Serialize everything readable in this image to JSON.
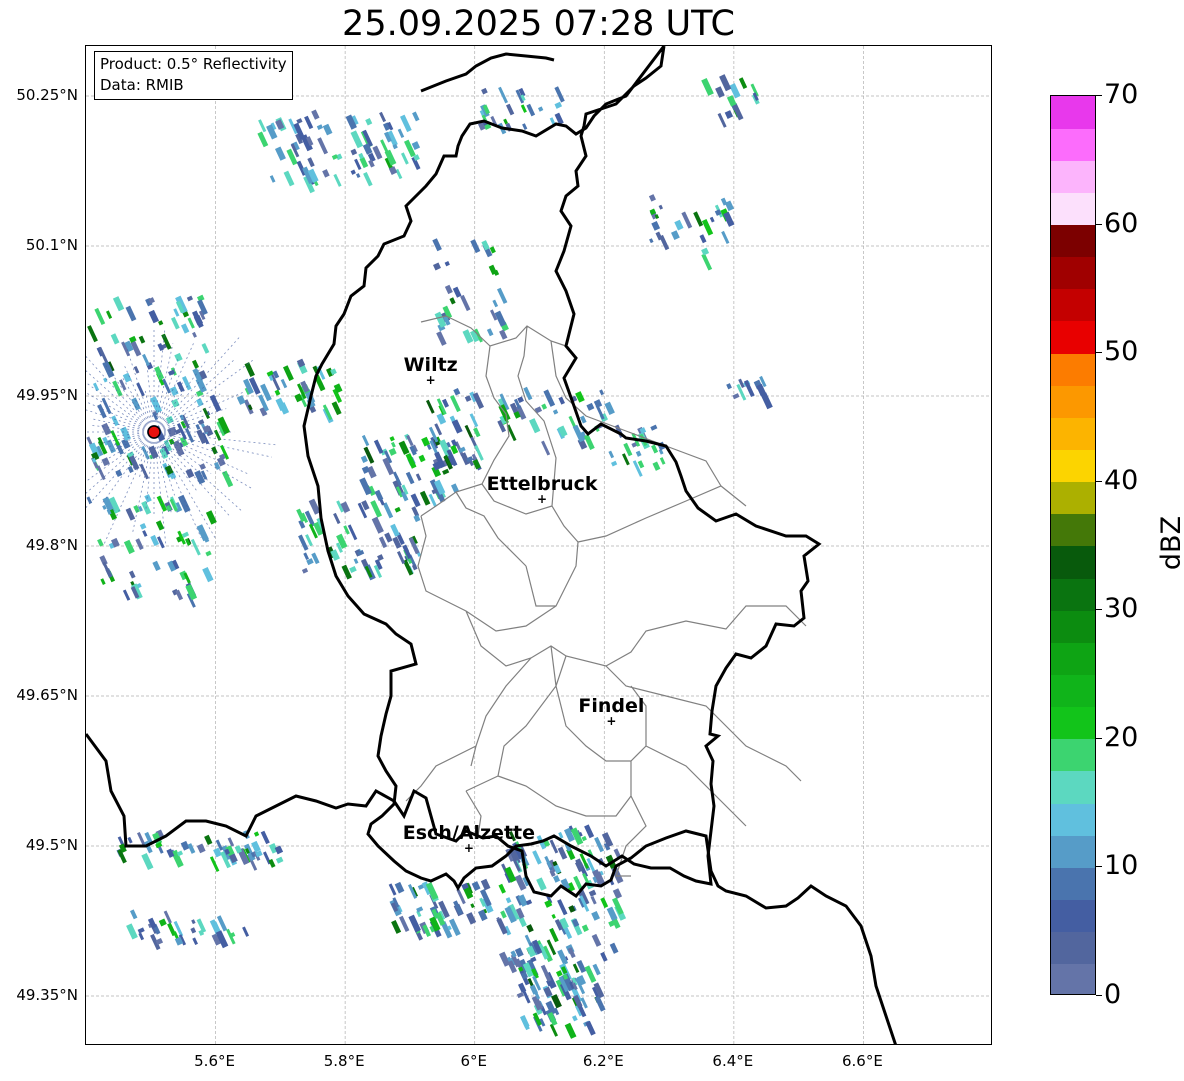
{
  "title": "25.09.2025 07:28 UTC",
  "info": {
    "product": "Product: 0.5° Reflectivity",
    "data": "Data: RMIB"
  },
  "map": {
    "lon_range": [
      5.4,
      6.8
    ],
    "lat_range": [
      49.3,
      50.3
    ],
    "lat_ticks": [
      {
        "value": 50.25,
        "label": "50.25°N"
      },
      {
        "value": 50.1,
        "label": "50.1°N"
      },
      {
        "value": 49.95,
        "label": "49.95°N"
      },
      {
        "value": 49.8,
        "label": "49.8°N"
      },
      {
        "value": 49.65,
        "label": "49.65°N"
      },
      {
        "value": 49.5,
        "label": "49.5°N"
      },
      {
        "value": 49.35,
        "label": "49.35°N"
      }
    ],
    "lon_ticks": [
      {
        "value": 5.6,
        "label": "5.6°E"
      },
      {
        "value": 5.8,
        "label": "5.8°E"
      },
      {
        "value": 6.0,
        "label": "6°E"
      },
      {
        "value": 6.2,
        "label": "6.2°E"
      },
      {
        "value": 6.4,
        "label": "6.4°E"
      },
      {
        "value": 6.6,
        "label": "6.6°E"
      }
    ],
    "radar_site": {
      "lon": 5.505,
      "lat": 49.914,
      "color": "#e8100e"
    },
    "cities": [
      {
        "name": "Wiltz",
        "lon": 5.932,
        "lat": 49.966
      },
      {
        "name": "Ettelbruck",
        "lon": 6.104,
        "lat": 49.847
      },
      {
        "name": "Findel",
        "lon": 6.211,
        "lat": 49.625
      },
      {
        "name": "Esch/Alzette",
        "lon": 5.991,
        "lat": 49.498
      }
    ]
  },
  "colorbar": {
    "label": "dBZ",
    "min": 0,
    "max": 70,
    "ticks": [
      {
        "value": 0,
        "label": "0"
      },
      {
        "value": 10,
        "label": "10"
      },
      {
        "value": 20,
        "label": "20"
      },
      {
        "value": 30,
        "label": "30"
      },
      {
        "value": 40,
        "label": "40"
      },
      {
        "value": 50,
        "label": "50"
      },
      {
        "value": 60,
        "label": "60"
      },
      {
        "value": 70,
        "label": "70"
      }
    ],
    "colors": [
      "#6474a8",
      "#52669e",
      "#445ea2",
      "#4a74ae",
      "#569cc8",
      "#60c0de",
      "#5cd8c0",
      "#3cd470",
      "#12c41a",
      "#10b41a",
      "#0ea414",
      "#0c8c10",
      "#0a7410",
      "#085a0c",
      "#447808",
      "#acb000",
      "#fcd400",
      "#fcb400",
      "#fc9800",
      "#fc7c00",
      "#e80000",
      "#c40000",
      "#a00000",
      "#7c0000",
      "#fce0fc",
      "#fcb4fc",
      "#fc6cfc",
      "#e838ec"
    ]
  }
}
